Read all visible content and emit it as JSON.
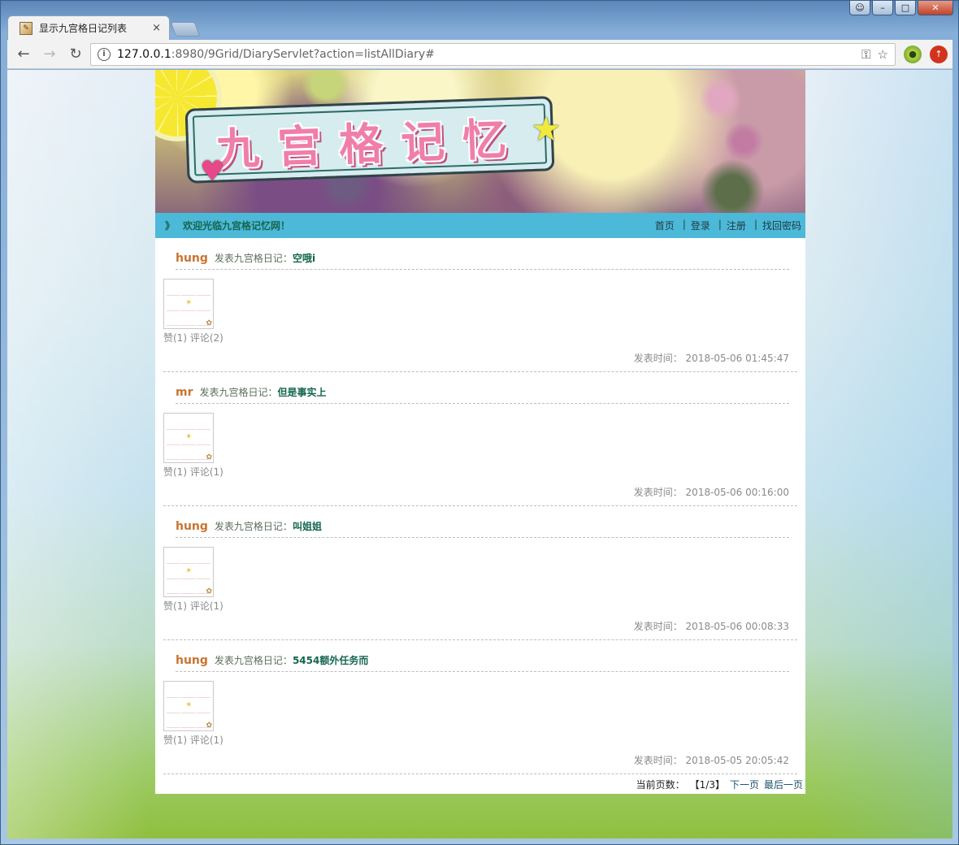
{
  "browser": {
    "tab_title": "显示九宫格日记列表",
    "tab_close": "×",
    "url_host": "127.0.0.1",
    "url_path": ":8980/9Grid/DiaryServlet?action=listAllDiary#",
    "icons": [
      "back-icon",
      "forward-icon",
      "reload-icon",
      "info-icon",
      "key-icon",
      "star-icon"
    ]
  },
  "banner": {
    "logo_text": "九宫格记忆"
  },
  "navbar": {
    "welcome_prefix": "》",
    "welcome": "欢迎光临九宫格记忆网！",
    "links": [
      {
        "label": "首页"
      },
      {
        "label": "登录"
      },
      {
        "label": "注册"
      },
      {
        "label": "找回密码"
      }
    ],
    "separator": "|"
  },
  "diaries": [
    {
      "author": "hung",
      "verb": "发表九宫格日记：",
      "title": "空哦i",
      "stats": "赞(1) 评论(2)",
      "time_label": "发表时间：",
      "time": "2018-05-06 01:45:47"
    },
    {
      "author": "mr",
      "verb": "发表九宫格日记：",
      "title": "但是事实上",
      "stats": "赞(1) 评论(1)",
      "time_label": "发表时间：",
      "time": "2018-05-06 00:16:00"
    },
    {
      "author": "hung",
      "verb": "发表九宫格日记：",
      "title": "叫姐姐",
      "stats": "赞(1) 评论(1)",
      "time_label": "发表时间：",
      "time": "2018-05-06 00:08:33"
    },
    {
      "author": "hung",
      "verb": "发表九宫格日记：",
      "title": "5454额外任务而",
      "stats": "赞(1) 评论(1)",
      "time_label": "发表时间：",
      "time": "2018-05-05 20:05:42"
    }
  ],
  "pager": {
    "current_label": "当前页数：",
    "current": "【1/3】",
    "next": "下一页",
    "last": "最后一页"
  },
  "colors": {
    "navbar": "#4cb9d8",
    "author": "#c8742f",
    "title": "#15664f",
    "welcome": "#16644f"
  }
}
